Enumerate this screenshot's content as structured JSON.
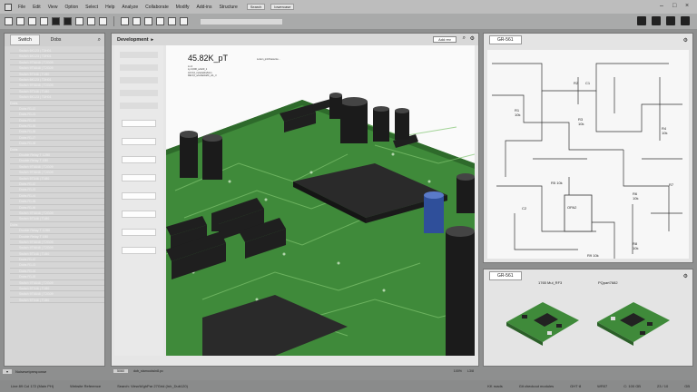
{
  "menubar": {
    "items": [
      "File",
      "Edit",
      "View",
      "Option",
      "Select",
      "Help",
      "Analyze",
      "Collaborate",
      "Modify",
      "Add-ins",
      "Structure"
    ],
    "search_label": "Search",
    "lowercase_pill": "lowercase"
  },
  "left_panel": {
    "tabs": [
      "Switch",
      "Dobs"
    ],
    "tree": [
      "Switch 6K123 | T3H01",
      "Switch 6K123 | T3H01",
      "Switch 9T6848 | T2G09",
      "Switch 9T6848 | T2G09",
      "Switch 5T548 | T1B0",
      "Switch 6K123 | T3H01",
      "Switch 9T6848 | T2G09",
      "Switch 5T548 | T1B0",
      "Switch 6K123 | T3H01",
      "Dobs",
      "Dobs R1-I2",
      "Dobs R1-I3",
      "Dobs R1-I4",
      "Dobs R1-I5",
      "Dobs R1-I6",
      "Dobs R1-I7",
      "Dobs R1-I8",
      "Dobs",
      "Double Relay T 12B0",
      "Double Relay T 1B0",
      "Switch 9T6848 | T2G09",
      "Switch 9T6848 | T2G09",
      "Switch 5T548 | T1B0",
      "Dobs R1-I2",
      "Dobs R1-I3",
      "Dobs R1-I4",
      "Dobs R1-I5",
      "Dobs R1-I6",
      "Switch 9T6848 | T2G09",
      "Switch 5T548 | T1B0",
      "Dobs",
      "Double Relay T 12B0",
      "Double Relay T 1B0",
      "Switch 9T6848 | T2G09",
      "Switch 9T6848 | T2G09",
      "Switch 5T548 | T1B0",
      "Dobs R1-I2",
      "Dobs R1-I3",
      "Dobs R1-I4",
      "Dobs R1-I5",
      "Switch 9T6848 | T2G09",
      "Switch 5T548 | T1B0",
      "Switch 9T6848 | T2G09",
      "Switch 5T548 | T1B0"
    ],
    "status": "Noisesetpresponse"
  },
  "center": {
    "title": "Development",
    "add_button": "Add rev",
    "readout": "45.82K_pT",
    "header_note": "Lorem_p4.0/vsource ..",
    "small_text": [
      "Lx:4",
      "Ly:4,000_s/rel/0_1",
      "AC:0,0_rn/ac/el/in/b/on",
      "RE:0,0_s/rel/la/rid/0r_ct1_r/"
    ],
    "footer_left": "5060",
    "footer_mid": "dob_stamocksin8.pc",
    "footer_right": [
      "100%",
      "L3/8"
    ]
  },
  "right_top": {
    "tag": "GR-561"
  },
  "right_bottom": {
    "tag": "GR-561",
    "labels": [
      "1765 Mul_RF3",
      "PQpart7682"
    ]
  },
  "status_bar": {
    "left": "Line 89 Col 172 (Main PH)",
    "ref": "Website Reference",
    "search": "Search: View/ld'ghPar 27Grid (ln/r_Dub120)",
    "right": [
      "KK roads",
      "Git checkout modules",
      "GHT·8",
      "WR07",
      "C: 100 GB",
      "23 / 10",
      "GB"
    ]
  },
  "colors": {
    "pcb": "#3f8a3a",
    "trace": "#7fc46f",
    "chip": "#2a2a2a",
    "cap": "#1f1f1f",
    "cap_blue": "#2f4f9a"
  }
}
